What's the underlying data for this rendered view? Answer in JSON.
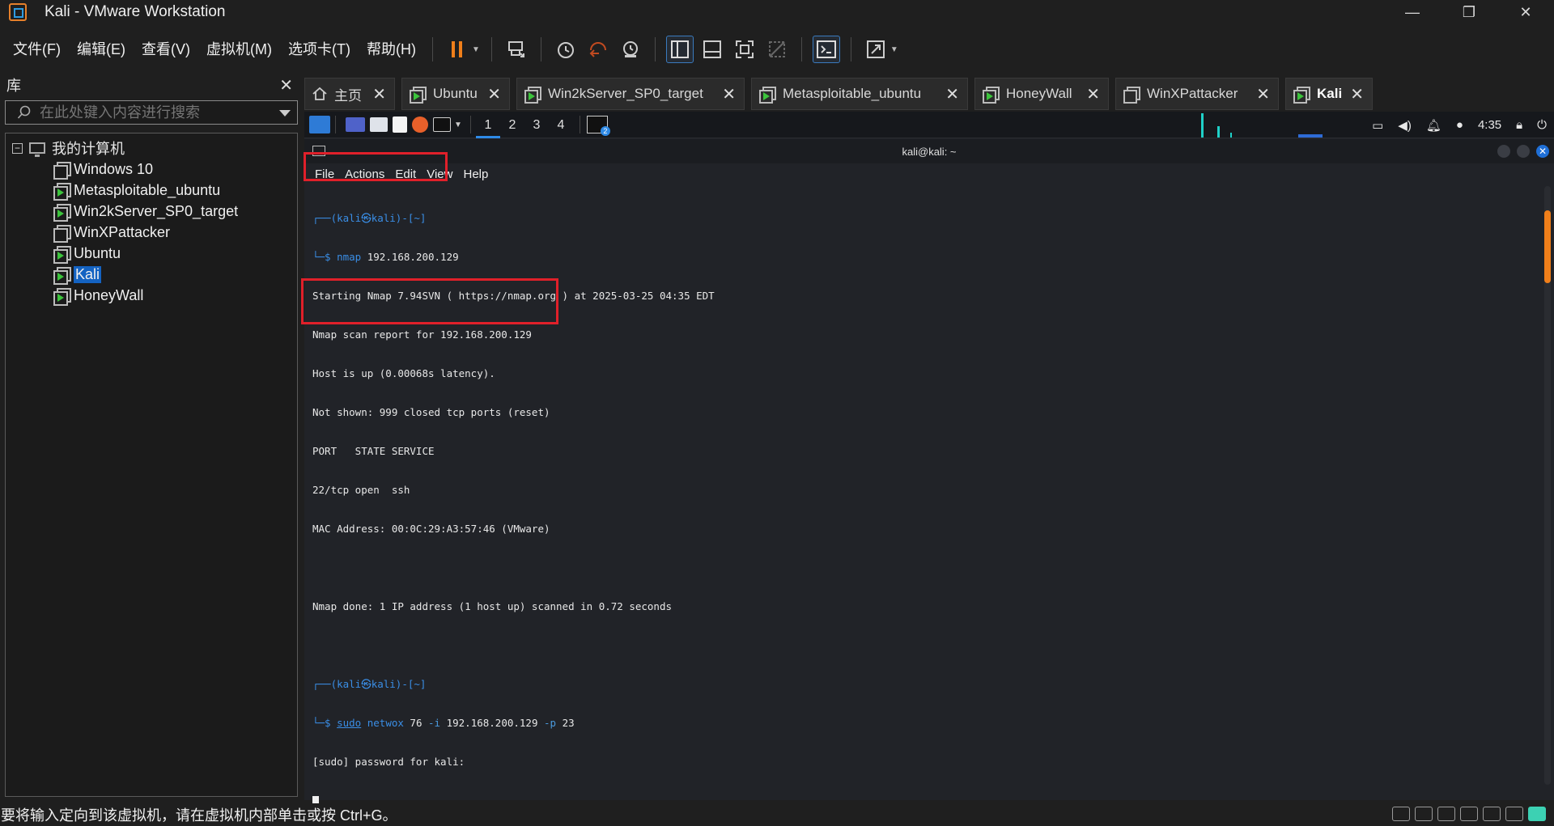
{
  "window": {
    "title": "Kali - VMware Workstation",
    "controls": [
      "—",
      "❐",
      "✕"
    ]
  },
  "menu": {
    "items": [
      "文件(F)",
      "编辑(E)",
      "查看(V)",
      "虚拟机(M)",
      "选项卡(T)",
      "帮助(H)"
    ]
  },
  "toolbar": {
    "icons": [
      "pause-icon",
      "send-ctrl-alt-del-icon",
      "snapshot-icon",
      "revert-snapshot-icon",
      "snapshot-manager-icon",
      "show-library-icon",
      "thumbnail-bar-icon",
      "fullscreen-icon",
      "unity-icon",
      "console-view-icon",
      "stretch-icon"
    ],
    "accent": "#f07f1a"
  },
  "library": {
    "title": "库",
    "search_placeholder": "在此处键入内容进行搜索",
    "root_label": "我的计算机",
    "items": [
      {
        "label": "Windows 10",
        "running": false,
        "selected": false
      },
      {
        "label": "Metasploitable_ubuntu",
        "running": true,
        "selected": false
      },
      {
        "label": "Win2kServer_SP0_target",
        "running": true,
        "selected": false
      },
      {
        "label": "WinXPattacker",
        "running": false,
        "selected": false
      },
      {
        "label": "Ubuntu",
        "running": true,
        "selected": false
      },
      {
        "label": "Kali",
        "running": true,
        "selected": true
      },
      {
        "label": "HoneyWall",
        "running": true,
        "selected": false
      }
    ]
  },
  "tabs": [
    {
      "label": "主页",
      "icon": "home-icon",
      "active": false
    },
    {
      "label": "Ubuntu",
      "icon": "vm-icon",
      "active": false
    },
    {
      "label": "Win2kServer_SP0_target",
      "icon": "vm-icon",
      "active": false
    },
    {
      "label": "Metasploitable_ubuntu",
      "icon": "vm-icon",
      "active": false
    },
    {
      "label": "HoneyWall",
      "icon": "vm-icon",
      "active": false
    },
    {
      "label": "WinXPattacker",
      "icon": "vm-icon-off",
      "active": false
    },
    {
      "label": "Kali",
      "icon": "vm-icon",
      "active": true
    }
  ],
  "guest_panel": {
    "workspaces": [
      "1",
      "2",
      "3",
      "4"
    ],
    "current_workspace": "1",
    "clock": "4:35",
    "terminal_badge": "2"
  },
  "terminal": {
    "title": "kali@kali: ~",
    "menu": [
      "File",
      "Actions",
      "Edit",
      "View",
      "Help"
    ],
    "prompt1_line1": "┌──(kali㉿kali)-[~]",
    "prompt1_line2_prefix": "└─$ ",
    "cmd1_name": "nmap",
    "cmd1_args": " 192.168.200.129",
    "output": [
      "Starting Nmap 7.94SVN ( https://nmap.org ) at 2025-03-25 04:35 EDT",
      "Nmap scan report for 192.168.200.129",
      "Host is up (0.00068s latency).",
      "Not shown: 999 closed tcp ports (reset)",
      "PORT   STATE SERVICE",
      "22/tcp open  ssh",
      "MAC Address: 00:0C:29:A3:57:46 (VMware)",
      "",
      "Nmap done: 1 IP address (1 host up) scanned in 0.72 seconds"
    ],
    "prompt2_line1": "┌──(kali㉿kali)-[~]",
    "prompt2_line2_prefix": "└─$ ",
    "cmd2_sudo": "sudo",
    "cmd2_name": " netwox",
    "cmd2_part1": " 76 ",
    "cmd2_flag1": "-i",
    "cmd2_part2": " 192.168.200.129 ",
    "cmd2_flag2": "-p",
    "cmd2_part3": " 23",
    "sudo_prompt": "[sudo] password for kali: "
  },
  "status": {
    "text": "要将输入定向到该虚拟机，请在虚拟机内部单击或按 Ctrl+G。"
  }
}
